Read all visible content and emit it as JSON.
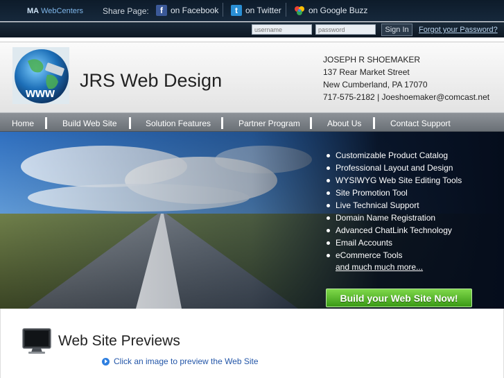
{
  "topbar": {
    "brand_strong": "MA",
    "brand_rest": "WebCenters",
    "share_label": "Share Page:",
    "share_items": [
      {
        "label": "on Facebook",
        "icon": "facebook-icon",
        "color": "#3b5998"
      },
      {
        "label": "on Twitter",
        "icon": "twitter-icon",
        "color": "#2a8fd4"
      },
      {
        "label": "on Google Buzz",
        "icon": "google-buzz-icon",
        "color": "#f4b400"
      }
    ]
  },
  "login": {
    "username_placeholder": "username",
    "password_placeholder": "password",
    "signin_label": "Sign In",
    "forgot_label": "Forgot your Password?"
  },
  "header": {
    "logo_text": "www",
    "site_title": "JRS Web Design",
    "contact": {
      "name": "JOSEPH R SHOEMAKER",
      "street": "137 Rear Market Street",
      "city": "New Cumberland, PA 17070",
      "phone_email": "717-575-2182 | Joeshoemaker@comcast.net"
    }
  },
  "nav": {
    "items": [
      "Home",
      "Build Web Site",
      "Solution Features",
      "Partner Program",
      "About Us",
      "Contact Support"
    ]
  },
  "hero": {
    "features": [
      "Customizable Product Catalog",
      "Professional Layout and Design",
      "WYSIWYG Web Site Editing Tools",
      "Site Promotion Tool",
      "Live Technical Support",
      "Domain Name Registration",
      "Advanced ChatLink Technology",
      "Email Accounts",
      "eCommerce Tools"
    ],
    "more_label": "and much much more...",
    "cta_label": "Build your Web Site Now!",
    "cta_color": "#4caf1f"
  },
  "previews": {
    "title": "Web Site Previews",
    "hint": "Click an image to preview the Web Site"
  }
}
